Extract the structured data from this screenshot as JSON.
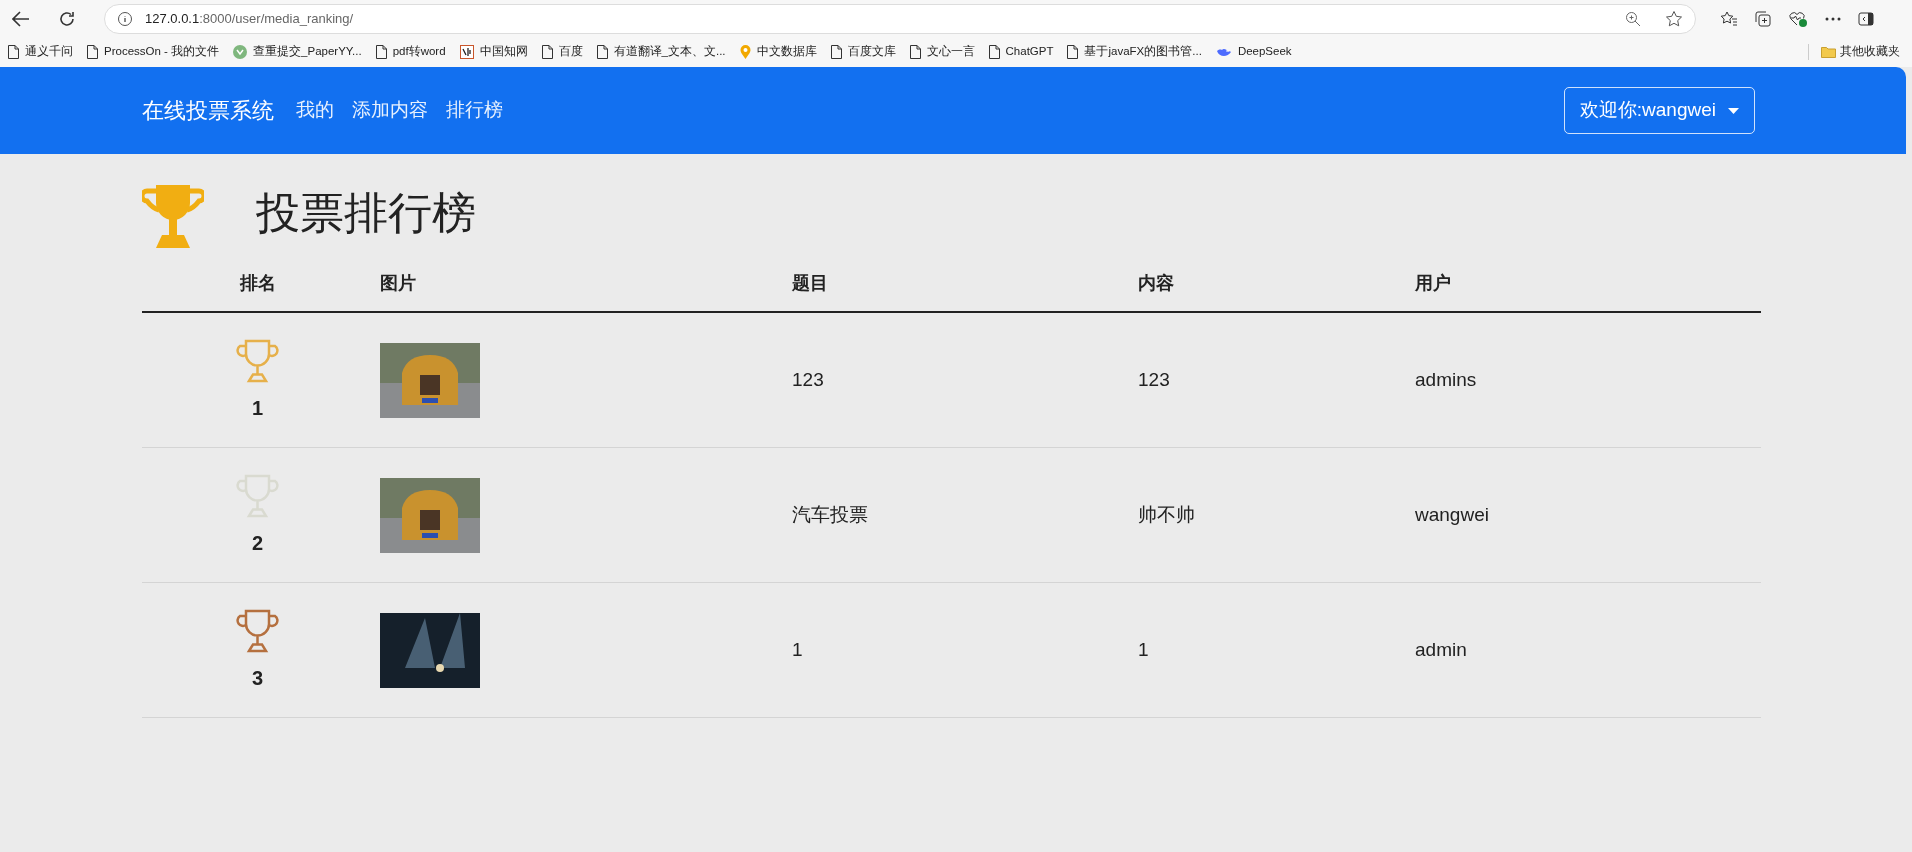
{
  "browser": {
    "address": {
      "host": "127.0.0.1",
      "path": ":8000/user/media_ranking/"
    },
    "bookmarks": [
      {
        "label": "通义千问",
        "kind": "page"
      },
      {
        "label": "ProcessOn - 我的文件",
        "kind": "page"
      },
      {
        "label": "查重提交_PaperYY...",
        "kind": "badge"
      },
      {
        "label": "pdf转word",
        "kind": "page"
      },
      {
        "label": "中国知网",
        "kind": "logo"
      },
      {
        "label": "百度",
        "kind": "page"
      },
      {
        "label": "有道翻译_文本、文...",
        "kind": "page"
      },
      {
        "label": "中文数据库",
        "kind": "pin"
      },
      {
        "label": "百度文库",
        "kind": "page"
      },
      {
        "label": "文心一言",
        "kind": "page"
      },
      {
        "label": "ChatGPT",
        "kind": "page"
      },
      {
        "label": "基于javaFX的图书管...",
        "kind": "page"
      },
      {
        "label": "DeepSeek",
        "kind": "whale"
      }
    ],
    "other_bookmarks": "其他收藏夹"
  },
  "navbar": {
    "brand": "在线投票系统",
    "links": [
      "我的",
      "添加内容",
      "排行榜"
    ],
    "user_menu": "欢迎你:wangwei"
  },
  "heading": "投票排行榜",
  "table": {
    "columns": [
      "排名",
      "图片",
      "题目",
      "内容",
      "用户"
    ],
    "rows": [
      {
        "rank": "1",
        "color": "#e6b04a",
        "kind": "car",
        "title": "123",
        "content": "123",
        "user": "admins"
      },
      {
        "rank": "2",
        "color": "#d9dad0",
        "kind": "car",
        "title": "汽车投票",
        "content": "帅不帅",
        "user": "wangwei"
      },
      {
        "rank": "3",
        "color": "#b5703f",
        "kind": "stage",
        "title": "1",
        "content": "1",
        "user": "admin"
      }
    ]
  }
}
